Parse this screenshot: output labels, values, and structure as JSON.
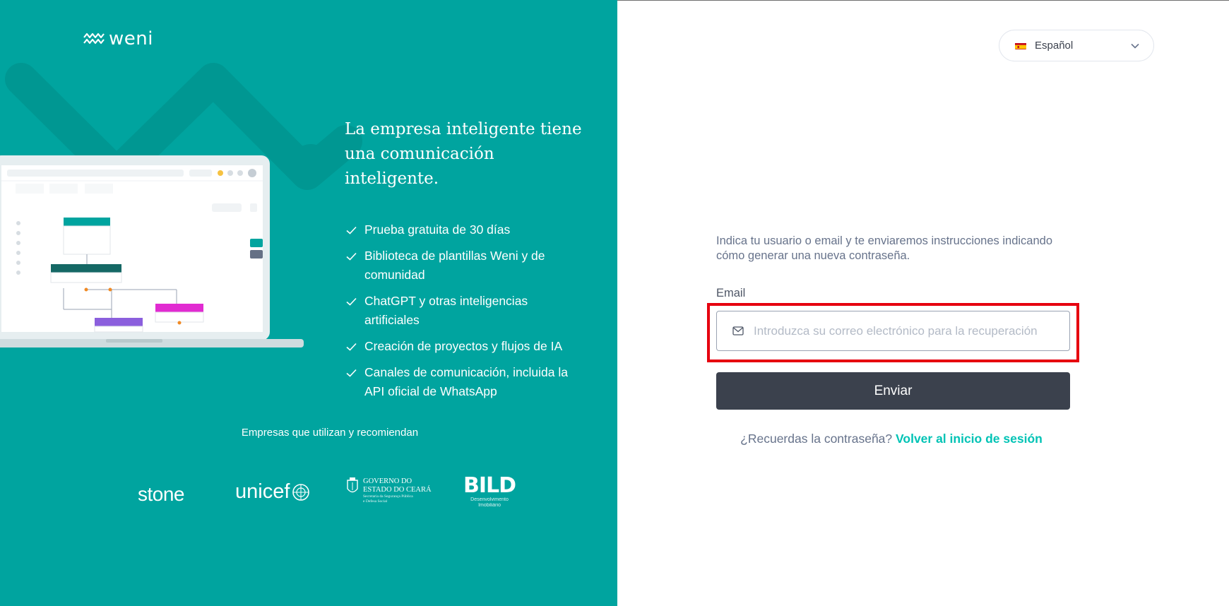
{
  "brand": {
    "name": "weni"
  },
  "left_panel": {
    "headline": "La empresa inteligente tiene una comunicación inteligente.",
    "features": [
      "Prueba gratuita de 30 días",
      "Biblioteca de plantillas Weni y de comunidad",
      "ChatGPT y otras inteligencias artificiales",
      "Creación de proyectos y flujos de IA",
      "Canales de comunicación, incluida la API oficial de WhatsApp"
    ],
    "companies_title": "Empresas que utilizan y recomiendan",
    "companies": {
      "stone": "stone",
      "unicef": "unicef",
      "ceara_line1": "GOVERNO DO",
      "ceara_line2": "ESTADO DO CEARÁ",
      "ceara_sub1": "Secretaria da Segurança Pública",
      "ceara_sub2": "e Defesa Social",
      "bild": "BILD",
      "bild_sub1": "Desenvolvimento",
      "bild_sub2": "Imobiliário"
    }
  },
  "language_selector": {
    "selected": "Español"
  },
  "form": {
    "instructions": "Indica tu usuario o email y te enviaremos instrucciones indicando cómo generar una nueva contraseña.",
    "email_label": "Email",
    "email_placeholder": "Introduzca su correo electrónico para la recuperación",
    "email_value": "",
    "submit_label": "Enviar",
    "back_prompt": "¿Recuerdas la contraseña?",
    "back_link": "Volver al inicio de sesión"
  },
  "colors": {
    "left_bg": "#00a49f",
    "button_bg": "#3b414d",
    "link": "#00c3b5",
    "highlight": "#e6000f"
  }
}
